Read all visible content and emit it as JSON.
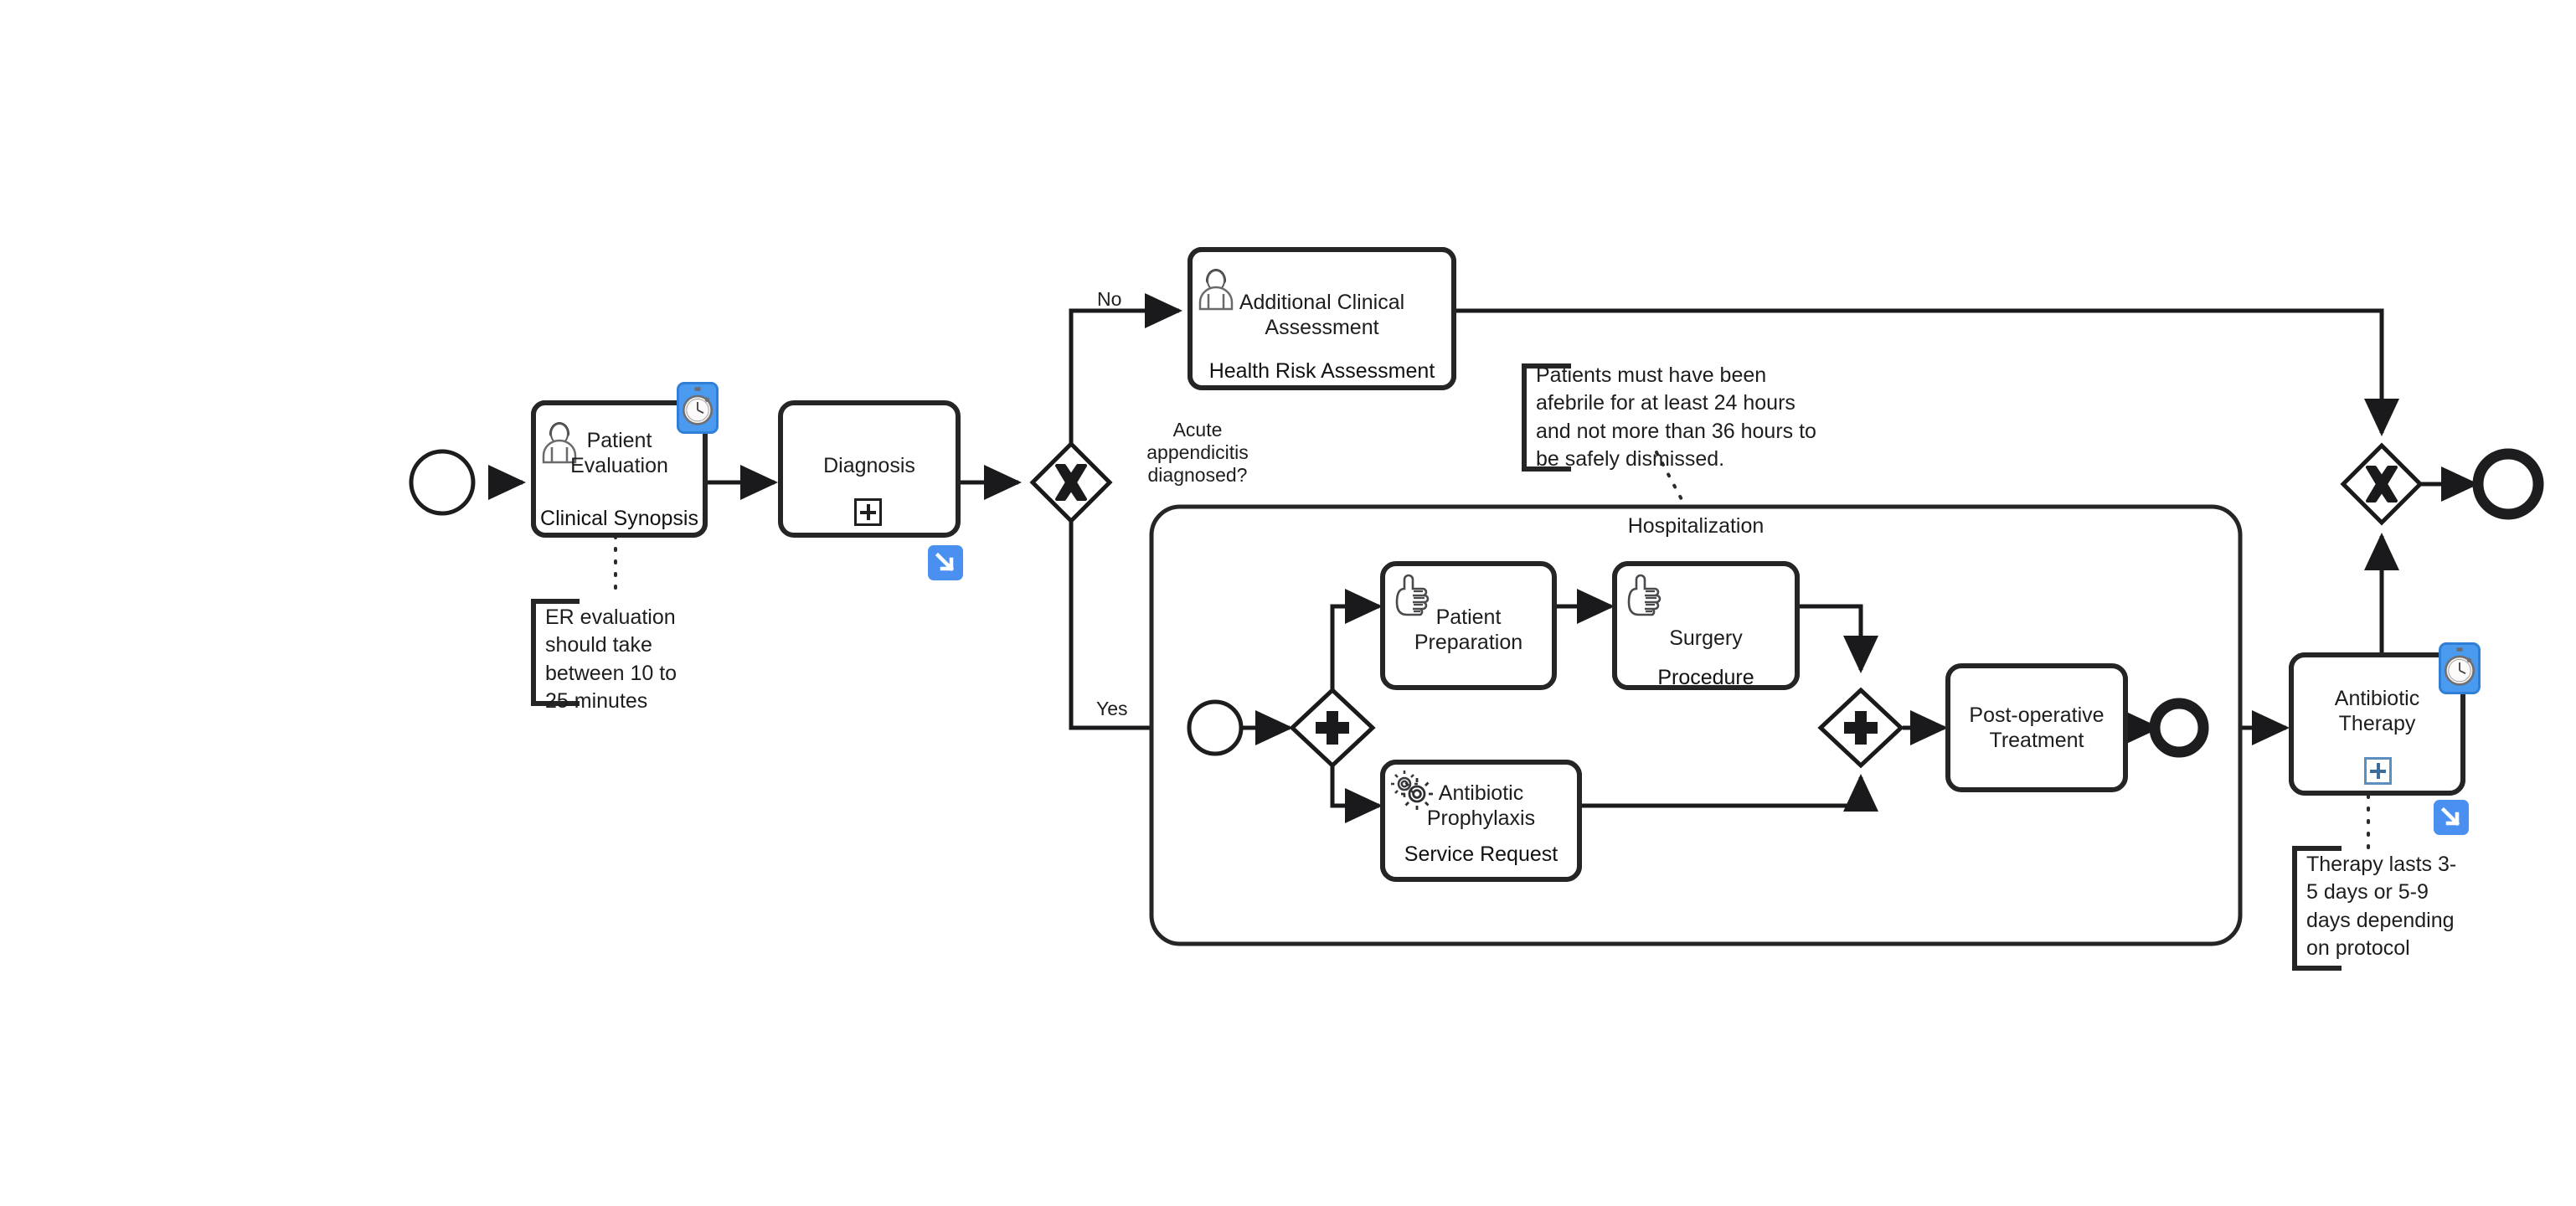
{
  "diagram": {
    "title": "Acute Appendicitis Clinical Pathway (BPMN)",
    "accent_blue": "#aad7f7",
    "badge_blue": "#4a9bf0",
    "line_color": "#1a1a1c"
  },
  "events": {
    "start": {
      "name": "start-event",
      "label": ""
    },
    "end": {
      "name": "end-event",
      "label": ""
    },
    "sub_start": {
      "name": "subprocess-start-event",
      "label": ""
    },
    "sub_end": {
      "name": "subprocess-end-event",
      "label": ""
    }
  },
  "tasks": [
    {
      "id": "patient-evaluation",
      "label": "Patient\nEvaluation",
      "band": "Clinical Synopsis",
      "icon": "user-icon",
      "badge": "timer-badge-icon",
      "marker": null
    },
    {
      "id": "diagnosis",
      "label": "Diagnosis",
      "band": null,
      "icon": null,
      "badge": "link-badge-icon",
      "marker": "plus-marker"
    },
    {
      "id": "additional-clinical-assessment",
      "label": "Additional Clinical\nAssessment",
      "band": "Health Risk Assessment",
      "icon": "user-icon",
      "badge": null,
      "marker": null
    },
    {
      "id": "patient-preparation",
      "label": "Patient\nPreparation",
      "band": null,
      "icon": "hand-icon",
      "badge": null,
      "marker": null
    },
    {
      "id": "surgery",
      "label": "Surgery",
      "band": "Procedure",
      "icon": "hand-icon",
      "badge": null,
      "marker": null
    },
    {
      "id": "antibiotic-prophylaxis",
      "label": "Antibiotic\nProphylaxis",
      "band": "Service Request",
      "icon": "gear-icon",
      "badge": null,
      "marker": null
    },
    {
      "id": "post-operative-treatment",
      "label": "Post-operative\nTreatment",
      "band": null,
      "icon": null,
      "badge": null,
      "marker": null
    },
    {
      "id": "antibiotic-therapy",
      "label": "Antibiotic\nTherapy",
      "band": "",
      "icon": null,
      "badge": "timer-badge-icon",
      "badge2": "link-badge-icon",
      "marker": "plus-marker"
    }
  ],
  "subprocess": {
    "id": "hospitalization",
    "title": "Hospitalization"
  },
  "gateways": [
    {
      "id": "diagnosis-decision-gateway",
      "type": "exclusive",
      "symbol": "X"
    },
    {
      "id": "parallel-split-gateway",
      "type": "parallel",
      "symbol": "+"
    },
    {
      "id": "parallel-join-gateway",
      "type": "parallel",
      "symbol": "+"
    },
    {
      "id": "merge-gateway",
      "type": "exclusive",
      "symbol": "X"
    }
  ],
  "flow_labels": {
    "no": "No",
    "yes": "Yes",
    "condition": "Acute\nappendicitis\ndiagnosed?"
  },
  "annotations": [
    {
      "id": "er-evaluation-note",
      "text": "ER evaluation\nshould take\nbetween 10 to\n25 minutes"
    },
    {
      "id": "afebrile-note",
      "text": "Patients must have been\nafebrile for at least 24 hours\nand not more than 36 hours to\nbe safely dismissed."
    },
    {
      "id": "therapy-duration-note",
      "text": "Therapy lasts 3-\n5 days or 5-9\ndays depending\non protocol"
    }
  ]
}
